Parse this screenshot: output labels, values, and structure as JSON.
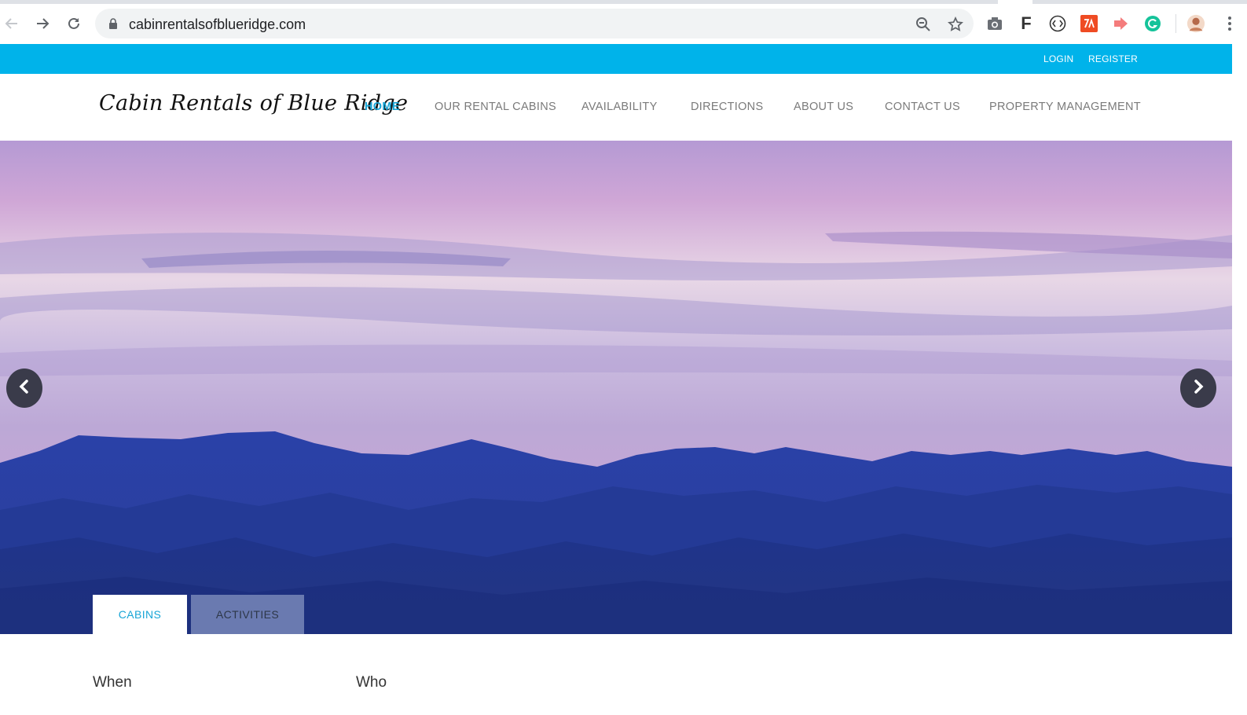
{
  "browser": {
    "url": "cabinrentalsofblueridge.com",
    "icons": [
      "back-arrow-icon",
      "forward-arrow-icon",
      "reload-icon",
      "lock-icon",
      "zoom-out-icon",
      "star-icon",
      "camera-icon",
      "f-extension-icon",
      "code-extension-icon",
      "pdf-extension-icon",
      "share-extension-icon",
      "grammarly-icon",
      "profile-avatar",
      "menu-dots-icon"
    ],
    "f_ext_label": "F"
  },
  "utility": {
    "login": "LOGIN",
    "register": "REGISTER",
    "color": "#00b3ea"
  },
  "header": {
    "logo": "Cabin Rentals of Blue Ridge",
    "nav": [
      {
        "label": "HOME",
        "active": true
      },
      {
        "label": "OUR RENTAL CABINS"
      },
      {
        "label": "AVAILABILITY"
      },
      {
        "label": "DIRECTIONS"
      },
      {
        "label": "ABOUT US"
      },
      {
        "label": "CONTACT US"
      },
      {
        "label": "PROPERTY MANAGEMENT"
      }
    ],
    "accent": "#18a5d6"
  },
  "hero": {
    "prev_icon": "chevron-left-icon",
    "next_icon": "chevron-right-icon",
    "tabs": [
      {
        "label": "CABINS",
        "active": true
      },
      {
        "label": "ACTIVITIES"
      }
    ]
  },
  "search": {
    "when_label": "When",
    "who_label": "Who"
  }
}
